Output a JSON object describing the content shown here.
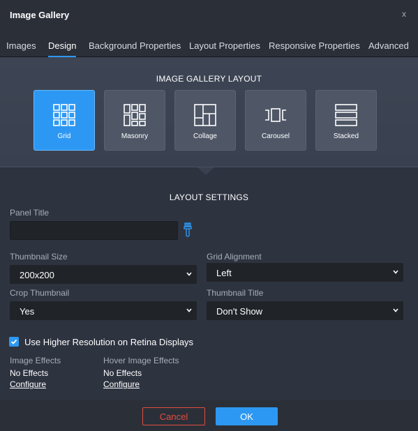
{
  "window": {
    "title": "Image Gallery",
    "close_label": "x"
  },
  "tabs": [
    {
      "label": "Images"
    },
    {
      "label": "Design"
    },
    {
      "label": "Background Properties"
    },
    {
      "label": "Layout Properties"
    },
    {
      "label": "Responsive Properties"
    },
    {
      "label": "Advanced"
    }
  ],
  "active_tab": "Design",
  "layout_section": {
    "title": "IMAGE GALLERY LAYOUT",
    "options": [
      {
        "label": "Grid",
        "icon": "grid-icon"
      },
      {
        "label": "Masonry",
        "icon": "masonry-icon"
      },
      {
        "label": "Collage",
        "icon": "collage-icon"
      },
      {
        "label": "Carousel",
        "icon": "carousel-icon"
      },
      {
        "label": "Stacked",
        "icon": "stacked-icon"
      }
    ],
    "selected": "Grid"
  },
  "settings": {
    "title": "LAYOUT SETTINGS",
    "panel_title": {
      "label": "Panel Title",
      "value": "",
      "icon": "paintbrush-icon"
    },
    "thumbnail_size": {
      "label": "Thumbnail Size",
      "value": "200x200"
    },
    "grid_alignment": {
      "label": "Grid Alignment",
      "value": "Left"
    },
    "crop_thumbnail": {
      "label": "Crop Thumbnail",
      "value": "Yes"
    },
    "thumbnail_title": {
      "label": "Thumbnail Title",
      "value": "Don't Show"
    },
    "retina": {
      "label": "Use Higher Resolution on Retina Displays",
      "checked": true
    },
    "image_effects": {
      "label": "Image Effects",
      "value": "No Effects",
      "link": "Configure"
    },
    "hover_effects": {
      "label": "Hover Image Effects",
      "value": "No Effects",
      "link": "Configure"
    }
  },
  "footer": {
    "cancel_label": "Cancel",
    "ok_label": "OK"
  },
  "colors": {
    "accent": "#2d98f3",
    "danger": "#e34d40",
    "panel": "#2b2f38"
  }
}
